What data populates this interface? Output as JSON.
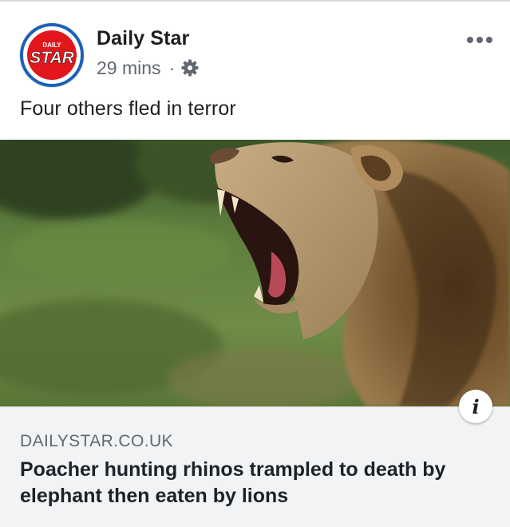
{
  "post": {
    "page_name": "Daily Star",
    "timestamp": "29 mins",
    "separator": "·",
    "privacy_icon": "gear-icon",
    "more_icon": "more-options-icon",
    "text": "Four others fled in terror"
  },
  "avatar": {
    "logo_small_text": "DAILY",
    "logo_text": "STAR",
    "brand_red": "#e2161d",
    "ring_blue": "#1d5fb8"
  },
  "link_preview": {
    "image_description_icon": "info-icon",
    "info_label": "i",
    "domain": "DAILYSTAR.CO.UK",
    "title": "Poacher hunting rhinos trampled to death by elephant then eaten by lions"
  },
  "colors": {
    "text_primary": "#1c1e21",
    "text_secondary": "#606770",
    "caption_bg": "#f2f3f5"
  }
}
